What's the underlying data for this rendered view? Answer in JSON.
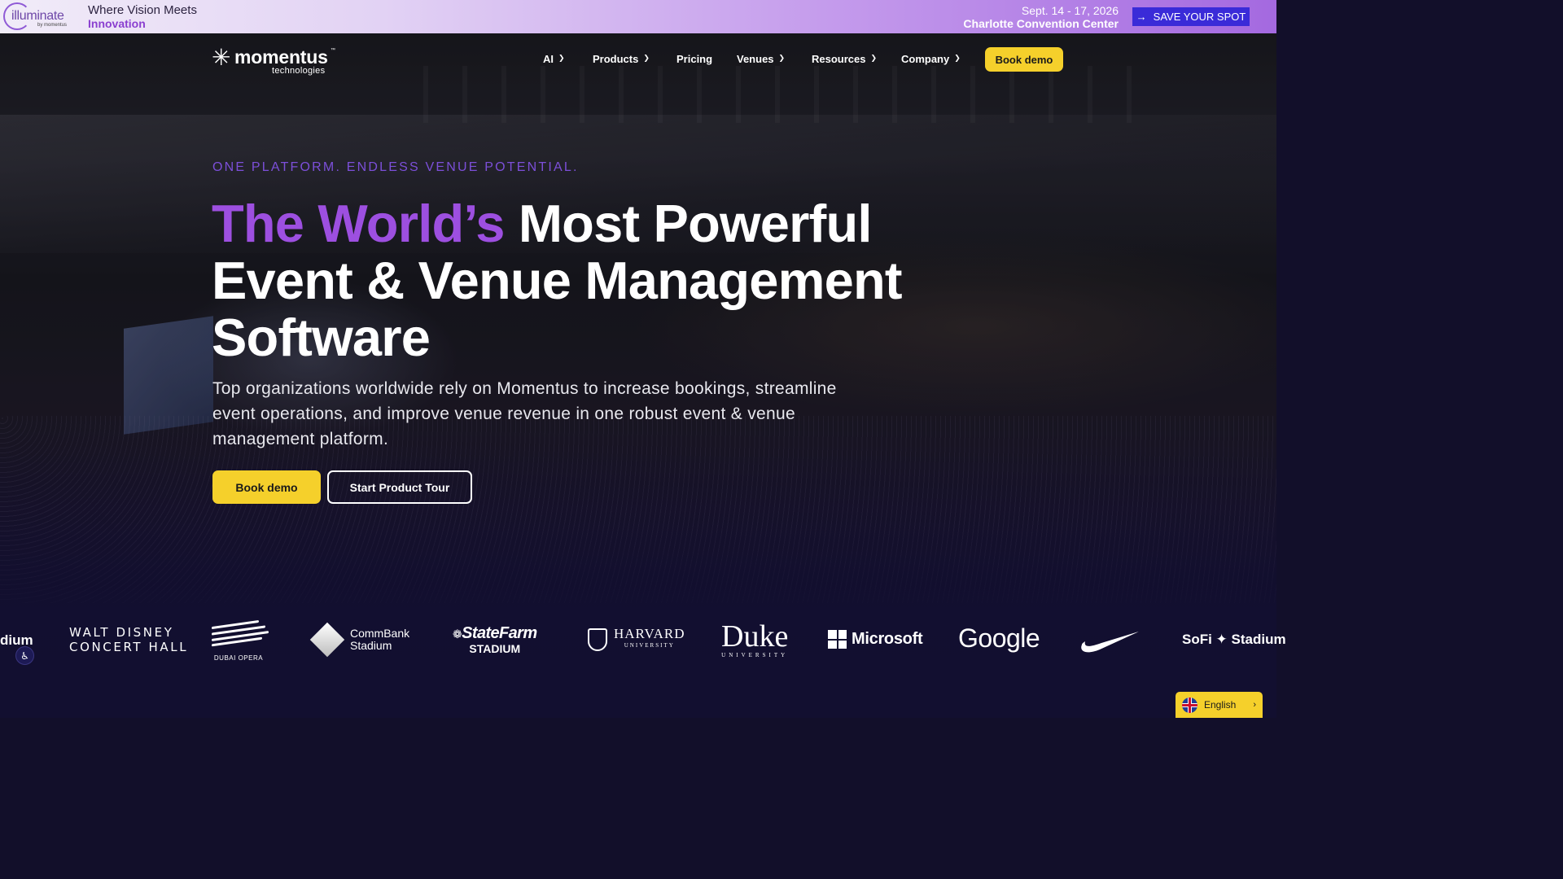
{
  "announcement": {
    "brand_logo_text": "illuminate",
    "brand_logo_sub": "by momentus",
    "tagline_line1": "Where Vision Meets",
    "tagline_line2": "Innovation",
    "dates": "Sept. 14 - 17, 2026",
    "location": "Charlotte Convention Center",
    "cta_label": "SAVE YOUR SPOT",
    "cta_icon": "arrow-right-icon"
  },
  "nav": {
    "logo_word": "momentus",
    "logo_sub": "technologies",
    "logo_tm": "™",
    "items": [
      {
        "label": "AI",
        "has_dropdown": true
      },
      {
        "label": "Products",
        "has_dropdown": true
      },
      {
        "label": "Pricing",
        "has_dropdown": false
      },
      {
        "label": "Venues",
        "has_dropdown": true
      },
      {
        "label": "Resources",
        "has_dropdown": true
      },
      {
        "label": "Company",
        "has_dropdown": true
      }
    ],
    "cta_label": "Book demo"
  },
  "hero": {
    "eyebrow": "ONE PLATFORM. ENDLESS VENUE POTENTIAL.",
    "headline_highlight": "The World’s",
    "headline_rest": "Most Powerful Event & Venue Management Software",
    "subcopy": "Top organizations worldwide rely on Momentus to increase bookings, streamline event operations, and improve venue revenue in one robust event & venue management platform.",
    "primary_cta": "Book demo",
    "secondary_cta": "Start Product Tour"
  },
  "clients": {
    "stadium_partial": "dium",
    "disney_line1": "WALT DISNEY",
    "disney_line2": "CONCERT HALL",
    "dubai": "DUBAI OPERA",
    "commbank_line1": "CommBank",
    "commbank_line2": "Stadium",
    "statefarm_line1": "StateFarm",
    "statefarm_line2": "STADIUM",
    "harvard": "HARVARD",
    "harvard_sub": "UNIVERSITY",
    "duke": "Duke",
    "duke_sub": "UNIVERSITY",
    "microsoft": "Microsoft",
    "google": "Google",
    "sofi": "SoFi ✦ Stadium"
  },
  "widgets": {
    "language": "English",
    "language_flag": "uk-flag-icon",
    "accessibility_icon": "accessibility-icon"
  },
  "colors": {
    "accent_yellow": "#f5d02b",
    "accent_purple": "#9d4fe0",
    "eyebrow_purple": "#7c4fd9",
    "save_button_blue": "#3a2bd8",
    "background_navy": "#120f30"
  }
}
